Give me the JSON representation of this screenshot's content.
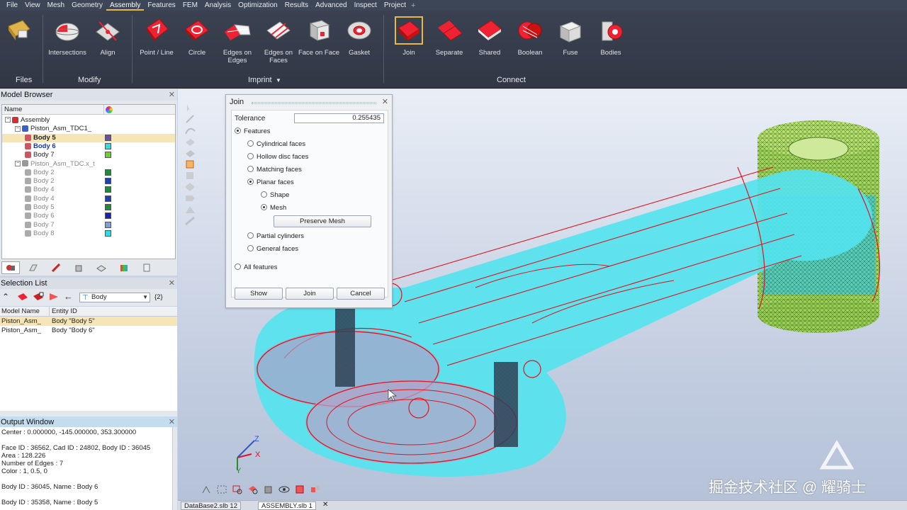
{
  "menu": {
    "items": [
      "File",
      "View",
      "Mesh",
      "Geometry",
      "Assembly",
      "Features",
      "FEM",
      "Analysis",
      "Optimization",
      "Results",
      "Advanced",
      "Inspect",
      "Project"
    ],
    "active": "Assembly",
    "add_icon": "plus-icon"
  },
  "ribbon": {
    "tools": {
      "files": "",
      "intersections": "Intersections",
      "align": "Align",
      "point_line": "Point / Line",
      "circle": "Circle",
      "edges_on_edges": "Edges on Edges",
      "edges_on_faces": "Edges on Faces",
      "face_on_face": "Face on Face",
      "gasket": "Gasket",
      "join": "Join",
      "separate": "Separate",
      "shared": "Shared",
      "boolean": "Boolean",
      "fuse": "Fuse",
      "bodies": "Bodies"
    },
    "groups": {
      "files": "Files",
      "modify": "Modify",
      "imprint": "Imprint",
      "connect": "Connect"
    }
  },
  "model_browser": {
    "title": "Model Browser",
    "col_name": "Name",
    "tree": [
      {
        "label": "Assembly",
        "color": ""
      },
      {
        "label": "Piston_Asm_TDC1_",
        "color": ""
      },
      {
        "label": "Body 5",
        "color": "#6b4fa3"
      },
      {
        "label": "Body 6",
        "color": "#22e0ee"
      },
      {
        "label": "Body 7",
        "color": "#6ad12a"
      },
      {
        "label": "Piston_Asm_TDC.x_t",
        "color": ""
      },
      {
        "label": "Body 2",
        "color": "#1a8f3a"
      },
      {
        "label": "Body 2",
        "color": "#1a3fbf"
      },
      {
        "label": "Body 4",
        "color": "#1a8f3a"
      },
      {
        "label": "Body 4",
        "color": "#1a3fbf"
      },
      {
        "label": "Body 5",
        "color": "#1a8f3a"
      },
      {
        "label": "Body 6",
        "color": "#1a1fbf"
      },
      {
        "label": "Body 7",
        "color": "#7f9fd6"
      },
      {
        "label": "Body 8",
        "color": "#22e0ee"
      }
    ]
  },
  "selection_list": {
    "title": "Selection List",
    "filter": "Body",
    "count": "{2}",
    "col_model": "Model Name",
    "col_entity": "Entity ID",
    "rows": [
      {
        "model": "Piston_Asm_",
        "entity": "Body \"Body 5\""
      },
      {
        "model": "Piston_Asm_",
        "entity": "Body \"Body 6\""
      }
    ]
  },
  "output_window": {
    "title": "Output Window",
    "lines": [
      "Center : 0.000000, -145.000000, 353.300000",
      "",
      "Face ID : 36562, Cad ID : 24802, Body ID : 36045",
      "Area : 128.226",
      "Number of Edges : 7",
      "Color : 1, 0.5, 0",
      "",
      "Body ID : 36045, Name : Body 6",
      "",
      "Body ID : 35358, Name : Body 5"
    ]
  },
  "join_dialog": {
    "title": "Join",
    "tolerance_label": "Tolerance",
    "tolerance_value": "0.255435",
    "features": "Features",
    "cylindrical": "Cylindrical faces",
    "hollow": "Hollow disc faces",
    "matching": "Matching faces",
    "planar": "Planar faces",
    "shape": "Shape",
    "mesh": "Mesh",
    "preserve": "Preserve Mesh",
    "partial": "Partial cylinders",
    "general": "General faces",
    "all": "All features",
    "show": "Show",
    "join": "Join",
    "cancel": "Cancel"
  },
  "axes": {
    "z": "Z",
    "x": "X",
    "y": "Y"
  },
  "status_tabs": [
    "DataBase2.slb 12",
    "ASSEMBLY.slb 1"
  ],
  "watermark": "掘金技术社区 @ 耀骑士",
  "colors": {
    "accent": "#e6b74a",
    "mesh_red": "#e0141e",
    "body_cyan": "#55e3ee",
    "piston_green": "#9fd64a"
  }
}
